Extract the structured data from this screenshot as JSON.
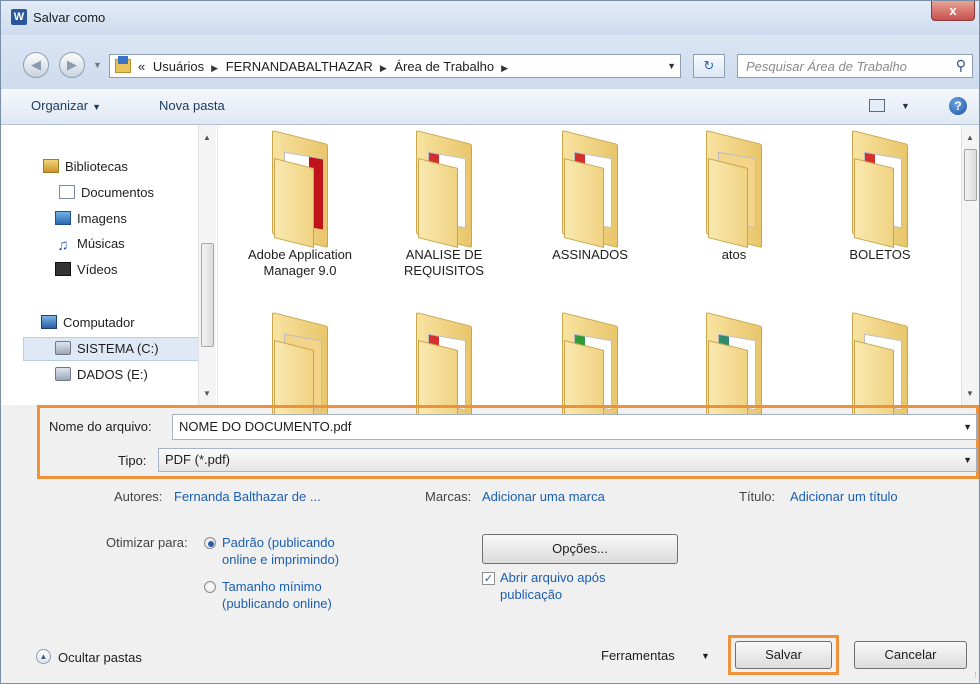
{
  "window": {
    "title": "Salvar como",
    "app_icon": "W",
    "close_label": "x"
  },
  "address": {
    "crumbs": [
      "«",
      "Usuários",
      "FERNANDABALTHAZAR",
      "Área de Trabalho"
    ],
    "search_placeholder": "Pesquisar Área de Trabalho"
  },
  "toolbar": {
    "organize": "Organizar",
    "new_folder": "Nova pasta",
    "help": "?"
  },
  "nav": {
    "libraries": "Bibliotecas",
    "documents": "Documentos",
    "images": "Imagens",
    "music": "Músicas",
    "videos": "Vídeos",
    "computer": "Computador",
    "drive_c": "SISTEMA (C:)",
    "drive_e": "DADOS (E:)"
  },
  "folders": [
    {
      "name": "Adobe Application Manager 9.0",
      "doc_accent": "#c0141c"
    },
    {
      "name": "ANALISE DE REQUISITOS",
      "doc_accent": "#d32f2f"
    },
    {
      "name": "ASSINADOS",
      "doc_accent": "#d32f2f"
    },
    {
      "name": "atos",
      "doc_accent": "#e0b04a"
    },
    {
      "name": "BOLETOS",
      "doc_accent": "#d32f2f"
    },
    {
      "name": "",
      "doc_accent": "#e0b04a"
    },
    {
      "name": "",
      "doc_accent": "#d32f2f"
    },
    {
      "name": "",
      "doc_accent": "#2e9a3a"
    },
    {
      "name": "",
      "doc_accent": "#2e8a6a"
    },
    {
      "name": "",
      "doc_accent": "#d8d8d8"
    }
  ],
  "form": {
    "filename_label": "Nome do arquivo:",
    "filename_value": "NOME DO DOCUMENTO.pdf",
    "type_label": "Tipo:",
    "type_value": "PDF (*.pdf)"
  },
  "meta": {
    "authors_label": "Autores:",
    "authors_value": "Fernanda Balthazar de ...",
    "tags_label": "Marcas:",
    "tags_value": "Adicionar uma marca",
    "title_label": "Título:",
    "title_value": "Adicionar um título"
  },
  "optimize": {
    "label": "Otimizar para:",
    "opt1_line1": "Padrão (publicando",
    "opt1_line2": "online e imprimindo)",
    "opt2_line1": "Tamanho mínimo",
    "opt2_line2": "(publicando online)",
    "selected": "standard"
  },
  "options_button": "Opções...",
  "open_after": {
    "line1": "Abrir arquivo após",
    "line2": "publicação",
    "checked": true
  },
  "bottom": {
    "hide_folders": "Ocultar pastas",
    "tools": "Ferramentas",
    "save": "Salvar",
    "cancel": "Cancelar"
  }
}
